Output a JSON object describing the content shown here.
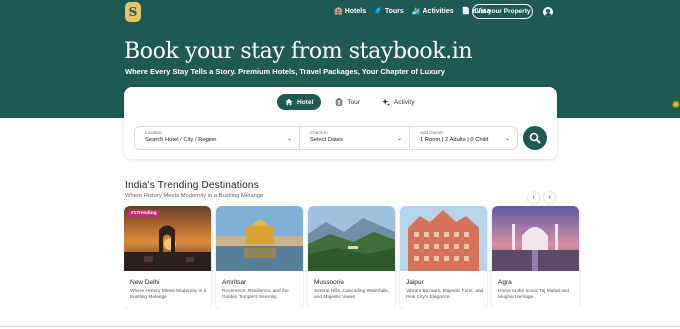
{
  "header": {
    "logo_letter": "S",
    "nav": [
      {
        "icon": "hotel-icon",
        "glyph": "🏨",
        "label": "Hotels"
      },
      {
        "icon": "tours-icon",
        "glyph": "🧳",
        "label": "Tours"
      },
      {
        "icon": "activities-icon",
        "glyph": "🏄",
        "label": "Activities"
      },
      {
        "icon": "evisa-icon",
        "glyph": "📄",
        "label": "eVisa"
      }
    ],
    "list_property": "List your Property"
  },
  "hero": {
    "title": "Book your stay from staybook.in",
    "subtitle": "Where Every Stay Tells a Story. Premium Hotels, Travel Packages, Your Chapter of Luxury"
  },
  "search": {
    "tabs": [
      {
        "label": "Hotel",
        "active": true
      },
      {
        "label": "Tour",
        "active": false
      },
      {
        "label": "Activity",
        "active": false
      }
    ],
    "location": {
      "label": "Location",
      "value": "Search Hotel / City / Region"
    },
    "checkin": {
      "label": "Check-in",
      "value": "Select Dates"
    },
    "guests": {
      "label": "Add Guests",
      "value": "1 Room | 2 Adults | 0 Child"
    }
  },
  "trending": {
    "title": "India's Trending Destinations",
    "subtitle": "Where History Meets Modernity in a Bustling Melange",
    "prev": "‹",
    "next": "›",
    "badge": "#1Trending",
    "cards": [
      {
        "name": "New Delhi",
        "desc": "Where History Meets Modernity in a Bustling Melange"
      },
      {
        "name": "Amritsar",
        "desc": "Reverence, Resilience, and the Golden Temple's Serenity."
      },
      {
        "name": "Mussoorie",
        "desc": "Serene Hills, Cascading Waterfalls, and Majestic Views."
      },
      {
        "name": "Jaipur",
        "desc": "Vibrant Bazaars, Majestic Forts, and Pink City's Elegance."
      },
      {
        "name": "Agra",
        "desc": "Home to the Iconic Taj Mahal and Mughal Heritage."
      }
    ]
  },
  "colors": {
    "brand": "#1e5a52",
    "accent": "#e7c46a",
    "badge": "#c62b7a"
  }
}
